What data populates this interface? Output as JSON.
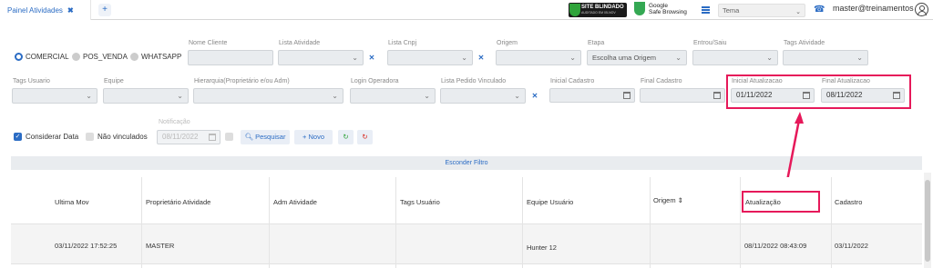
{
  "topbar": {
    "tab_label": "Painel Atividades",
    "tab_close": "✖",
    "add_tab": "+",
    "site_blindado": "SITE BLINDADO",
    "site_blindado_sub": "AUDITADO EM 05-NOV",
    "google_line1": "Google",
    "google_line2": "Safe Browsing",
    "theme_select": "Tema",
    "user": "master@treinamentos"
  },
  "filters": {
    "radio_comercial": "COMERCIAL",
    "radio_pos_venda": "POS_VENDA",
    "radio_whatsapp": "WHATSAPP",
    "nome_cliente": "Nome Cliente",
    "lista_atividade": "Lista Atividade",
    "lista_cnpj": "Lista Cnpj",
    "origem": "Origem",
    "etapa": "Etapa",
    "etapa_value": "Escolha uma Origem",
    "entrou_saiu": "Entrou/Saiu",
    "tags_atividade": "Tags Atividade",
    "tags_usuario": "Tags Usuario",
    "equipe": "Equipe",
    "hierarquia": "Hierarquia(Proprietário e/ou Adm)",
    "login_operadora": "Login Operadora",
    "lista_pedido": "Lista Pedido Vinculado",
    "inicial_cadastro": "Inicial Cadastro",
    "final_cadastro": "Final Cadastro",
    "inicial_atualizacao": "Inicial Atualizacao",
    "inicial_atualizacao_value": "01/11/2022",
    "final_atualizacao": "Final Atualizacao",
    "final_atualizacao_value": "08/11/2022",
    "considerar_data": "Considerar Data",
    "nao_vinculados": "Não vinculados",
    "notificacao": "Notificação",
    "notificacao_value": "08/11/2022",
    "pesquisar": "Pesquisar",
    "novo": "Novo",
    "clear_x": "✕",
    "esconder_filtro": "Esconder Filtro"
  },
  "table": {
    "headers": [
      "Ultima Mov",
      "Proprietário Atividade",
      "Adm Atividade",
      "Tags Usuário",
      "Equipe Usuário",
      "Origem ⇕",
      "Atualização",
      "Cadastro"
    ],
    "row": [
      "03/11/2022 17:52:25",
      "MASTER",
      "",
      "",
      "Hunter 12",
      "",
      "08/11/2022 08:43:09",
      "03/11/2022"
    ]
  },
  "colors": {
    "accent": "#2b6cc4",
    "highlight": "#e6195a"
  }
}
